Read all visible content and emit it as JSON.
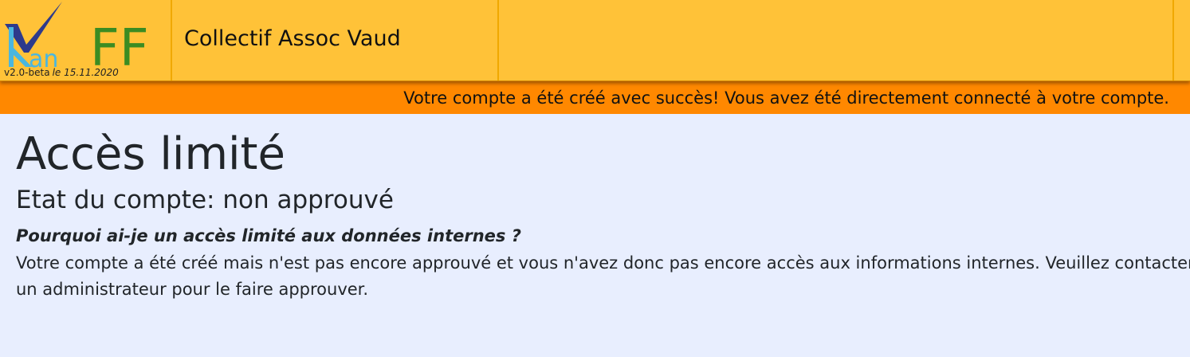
{
  "header": {
    "logo": {
      "text_kan": "Kan",
      "text_ff": "FF",
      "version": "v2.0-beta",
      "date": "le 15.11.2020"
    },
    "org_name": "Collectif Assoc Vaud"
  },
  "flash": {
    "message": "Votre compte a été créé avec succès! Vous avez été directement connecté à votre compte."
  },
  "main": {
    "title": "Accès limité",
    "status": "Etat du compte: non approuvé",
    "question": "Pourquoi ai-je un accès limité aux données internes ?",
    "explanation": "Votre compte a été créé mais n'est pas encore approuvé et vous n'avez donc pas encore accès aux informations internes. Veuillez contacter un administrateur pour le faire approuver."
  },
  "colors": {
    "header_bg": "#ffc238",
    "flash_bg": "#ff8800",
    "page_bg": "#e8eefe",
    "logo_blue": "#4ab6e0",
    "logo_green": "#3b8c22",
    "logo_dark": "#2e3a8c"
  }
}
